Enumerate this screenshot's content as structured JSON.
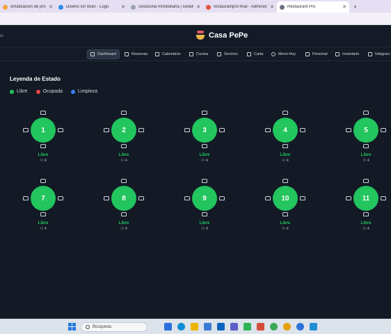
{
  "browser": {
    "tabs": [
      {
        "label": "omatización de procesos y",
        "icon_color": "#f2a33a"
      },
      {
        "label": "Diseño sin título - Logo",
        "icon_color": "#2b8be6"
      },
      {
        "label": "Soluziona Inmobiliaria | Getafe",
        "icon_color": "#9aa4b2"
      },
      {
        "label": "restaurantpro-final - Administr",
        "icon_color": "#e2553a"
      },
      {
        "label": "Restaurant Pro",
        "icon_color": "#6b7280",
        "active": true
      }
    ],
    "new_tab": "+"
  },
  "app": {
    "brand": "Casa PePe",
    "left_mark": "ei"
  },
  "nav": [
    {
      "label": "Dashboard",
      "icon": "grid-icon",
      "active": true
    },
    {
      "label": "Reservas",
      "icon": "clipboard-icon"
    },
    {
      "label": "Calendario",
      "icon": "calendar-icon"
    },
    {
      "label": "Cocina",
      "icon": "chef-hat-icon"
    },
    {
      "label": "Servicio",
      "icon": "utensils-icon"
    },
    {
      "label": "Carta",
      "icon": "book-icon"
    },
    {
      "label": "Menú Hoy",
      "icon": "sun-icon"
    },
    {
      "label": "Personal",
      "icon": "user-plus-icon"
    },
    {
      "label": "Inventario",
      "icon": "truck-icon"
    },
    {
      "label": "Integraci",
      "icon": "plug-icon"
    }
  ],
  "legend": {
    "title": "Leyenda de Estado",
    "items": [
      {
        "label": "Libre",
        "color": "#22c55e"
      },
      {
        "label": "Ocupada",
        "color": "#ef4444"
      },
      {
        "label": "Limpieza",
        "color": "#3b82f6"
      }
    ]
  },
  "tables": [
    {
      "number": "1",
      "status": "Libre",
      "capacity": "4"
    },
    {
      "number": "2",
      "status": "Libre",
      "capacity": "4"
    },
    {
      "number": "3",
      "status": "Libre",
      "capacity": "4"
    },
    {
      "number": "4",
      "status": "Libre",
      "capacity": "4"
    },
    {
      "number": "5",
      "status": "Libre",
      "capacity": "4"
    },
    {
      "number": "7",
      "status": "Libre",
      "capacity": "4"
    },
    {
      "number": "8",
      "status": "Libre",
      "capacity": "4"
    },
    {
      "number": "9",
      "status": "Libre",
      "capacity": "4"
    },
    {
      "number": "10",
      "status": "Libre",
      "capacity": "4"
    },
    {
      "number": "11",
      "status": "Libre",
      "capacity": "4"
    }
  ],
  "taskbar": {
    "search_placeholder": "Búsqueda",
    "pinned": [
      "start-icon",
      "widgets-icon",
      "edge-icon",
      "file-explorer-icon",
      "store-icon",
      "outlook-icon",
      "teams-icon",
      "whatsapp-icon",
      "app-icon",
      "chrome-icon",
      "chrome-alt-icon",
      "chrome-dev-icon",
      "photos-icon"
    ],
    "colors": [
      "#e05a8a",
      "#2a6fdb",
      "#0f8fd6",
      "#f0b400",
      "#3a7bd5",
      "#0a64c2",
      "#5b5fc7",
      "#2fb355",
      "#d14f3a",
      "#3aa757",
      "#e5a00d",
      "#2d73d9",
      "#1e90d6"
    ]
  }
}
